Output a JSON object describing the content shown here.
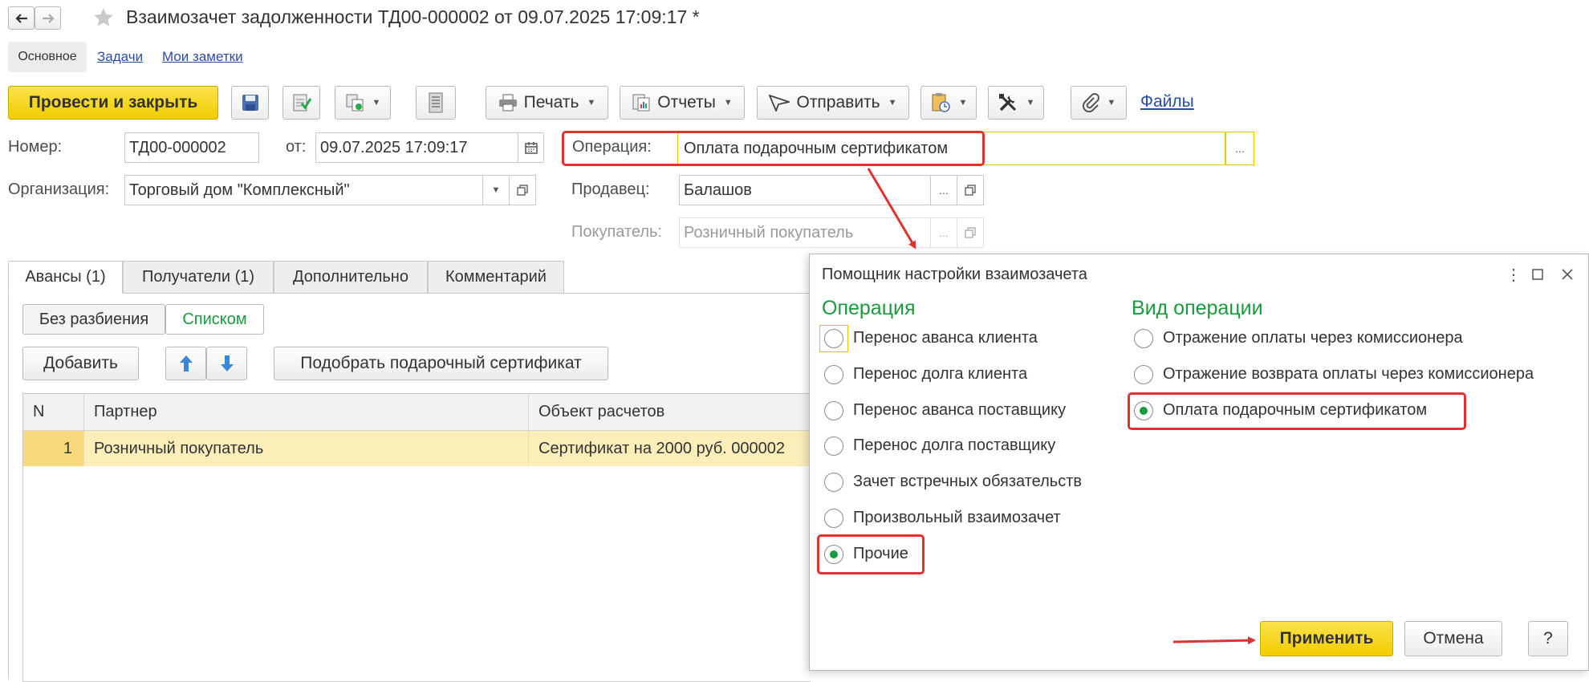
{
  "window": {
    "title": "Взаимозачет задолженности ТД00-000002 от 09.07.2025 17:09:17 *"
  },
  "nav_tabs": [
    {
      "label": "Основное"
    },
    {
      "label": "Задачи"
    },
    {
      "label": "Мои заметки"
    }
  ],
  "toolbar": {
    "post_close_label": "Провести и закрыть",
    "print_label": "Печать",
    "reports_label": "Отчеты",
    "send_label": "Отправить",
    "files_label": "Файлы"
  },
  "form": {
    "number_label": "Номер:",
    "number_value": "ТД00-000002",
    "date_label": "от:",
    "date_value": "09.07.2025 17:09:17",
    "operation_label": "Операция:",
    "operation_value": "Оплата подарочным сертификатом",
    "org_label": "Организация:",
    "org_value": "Торговый дом \"Комплексный\"",
    "seller_label": "Продавец:",
    "seller_value": "Балашов",
    "buyer_label": "Покупатель:",
    "buyer_value": "Розничный покупатель",
    "ellipsis": "..."
  },
  "tabs": [
    {
      "label": "Авансы (1)"
    },
    {
      "label": "Получатели (1)"
    },
    {
      "label": "Дополнительно"
    },
    {
      "label": "Комментарий"
    }
  ],
  "view_toggle": {
    "no_split": "Без разбиения",
    "list": "Списком"
  },
  "table_toolbar": {
    "add_label": "Добавить",
    "pick_label": "Подобрать подарочный сертификат"
  },
  "table": {
    "headers": [
      "N",
      "Партнер",
      "Объект расчетов"
    ],
    "rows": [
      {
        "n": "1",
        "partner": "Розничный покупатель",
        "object": "Сертификат на 2000 руб. 000002"
      }
    ]
  },
  "dialog": {
    "title": "Помощник настройки взаимозачета",
    "operation_heading": "Операция",
    "operation_options": [
      {
        "label": "Перенос аванса клиента",
        "checked": false
      },
      {
        "label": "Перенос долга клиента",
        "checked": false
      },
      {
        "label": "Перенос аванса поставщику",
        "checked": false
      },
      {
        "label": "Перенос долга поставщику",
        "checked": false
      },
      {
        "label": "Зачет встречных обязательств",
        "checked": false
      },
      {
        "label": "Произвольный взаимозачет",
        "checked": false
      },
      {
        "label": "Прочие",
        "checked": true
      }
    ],
    "type_heading": "Вид операции",
    "type_options": [
      {
        "label": "Отражение оплаты через комиссионера",
        "checked": false
      },
      {
        "label": "Отражение возврата оплаты через комиссионера",
        "checked": false
      },
      {
        "label": "Оплата подарочным сертификатом",
        "checked": true
      }
    ],
    "apply_label": "Применить",
    "cancel_label": "Отмена",
    "help_label": "?"
  },
  "colors": {
    "primary_button": "#f5d40f",
    "heading_green": "#1a9a3e",
    "highlight_red": "#e03030",
    "row_selected": "#fbeeb9"
  }
}
